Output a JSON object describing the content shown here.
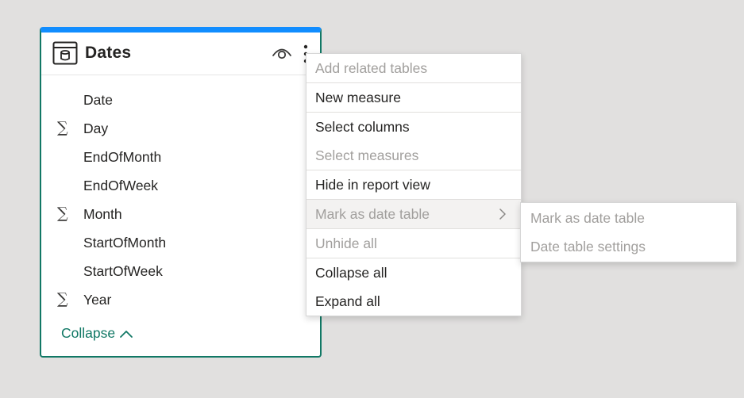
{
  "colors": {
    "canvas": "#e1e0df",
    "card_top_border": "#118dff",
    "card_border": "#117865",
    "collapse_link": "#117865",
    "text_enabled": "#252423",
    "text_disabled": "#a19f9d"
  },
  "table_card": {
    "title": "Dates",
    "header_icon": "table-icon",
    "visibility_icon": "eye-icon",
    "more_icon": "more-options-icon",
    "fields": [
      {
        "label": "Date",
        "sigma": ""
      },
      {
        "label": "Day",
        "sigma": "∑"
      },
      {
        "label": "EndOfMonth",
        "sigma": ""
      },
      {
        "label": "EndOfWeek",
        "sigma": ""
      },
      {
        "label": "Month",
        "sigma": "∑"
      },
      {
        "label": "StartOfMonth",
        "sigma": ""
      },
      {
        "label": "StartOfWeek",
        "sigma": ""
      },
      {
        "label": "Year",
        "sigma": "∑"
      }
    ],
    "collapse_label": "Collapse"
  },
  "context_menu": {
    "items": [
      {
        "label": "Add related tables",
        "enabled": false
      },
      {
        "label": "New measure",
        "enabled": true
      },
      {
        "label": "Select columns",
        "enabled": true
      },
      {
        "label": "Select measures",
        "enabled": false
      },
      {
        "label": "Hide in report view",
        "enabled": true
      },
      {
        "label": "Mark as date table",
        "enabled": false,
        "has_submenu": true
      },
      {
        "label": "Unhide all",
        "enabled": false
      },
      {
        "label": "Collapse all",
        "enabled": true
      },
      {
        "label": "Expand all",
        "enabled": true
      }
    ]
  },
  "submenu": {
    "items": [
      {
        "label": "Mark as date table",
        "enabled": false
      },
      {
        "label": "Date table settings",
        "enabled": false
      }
    ]
  }
}
